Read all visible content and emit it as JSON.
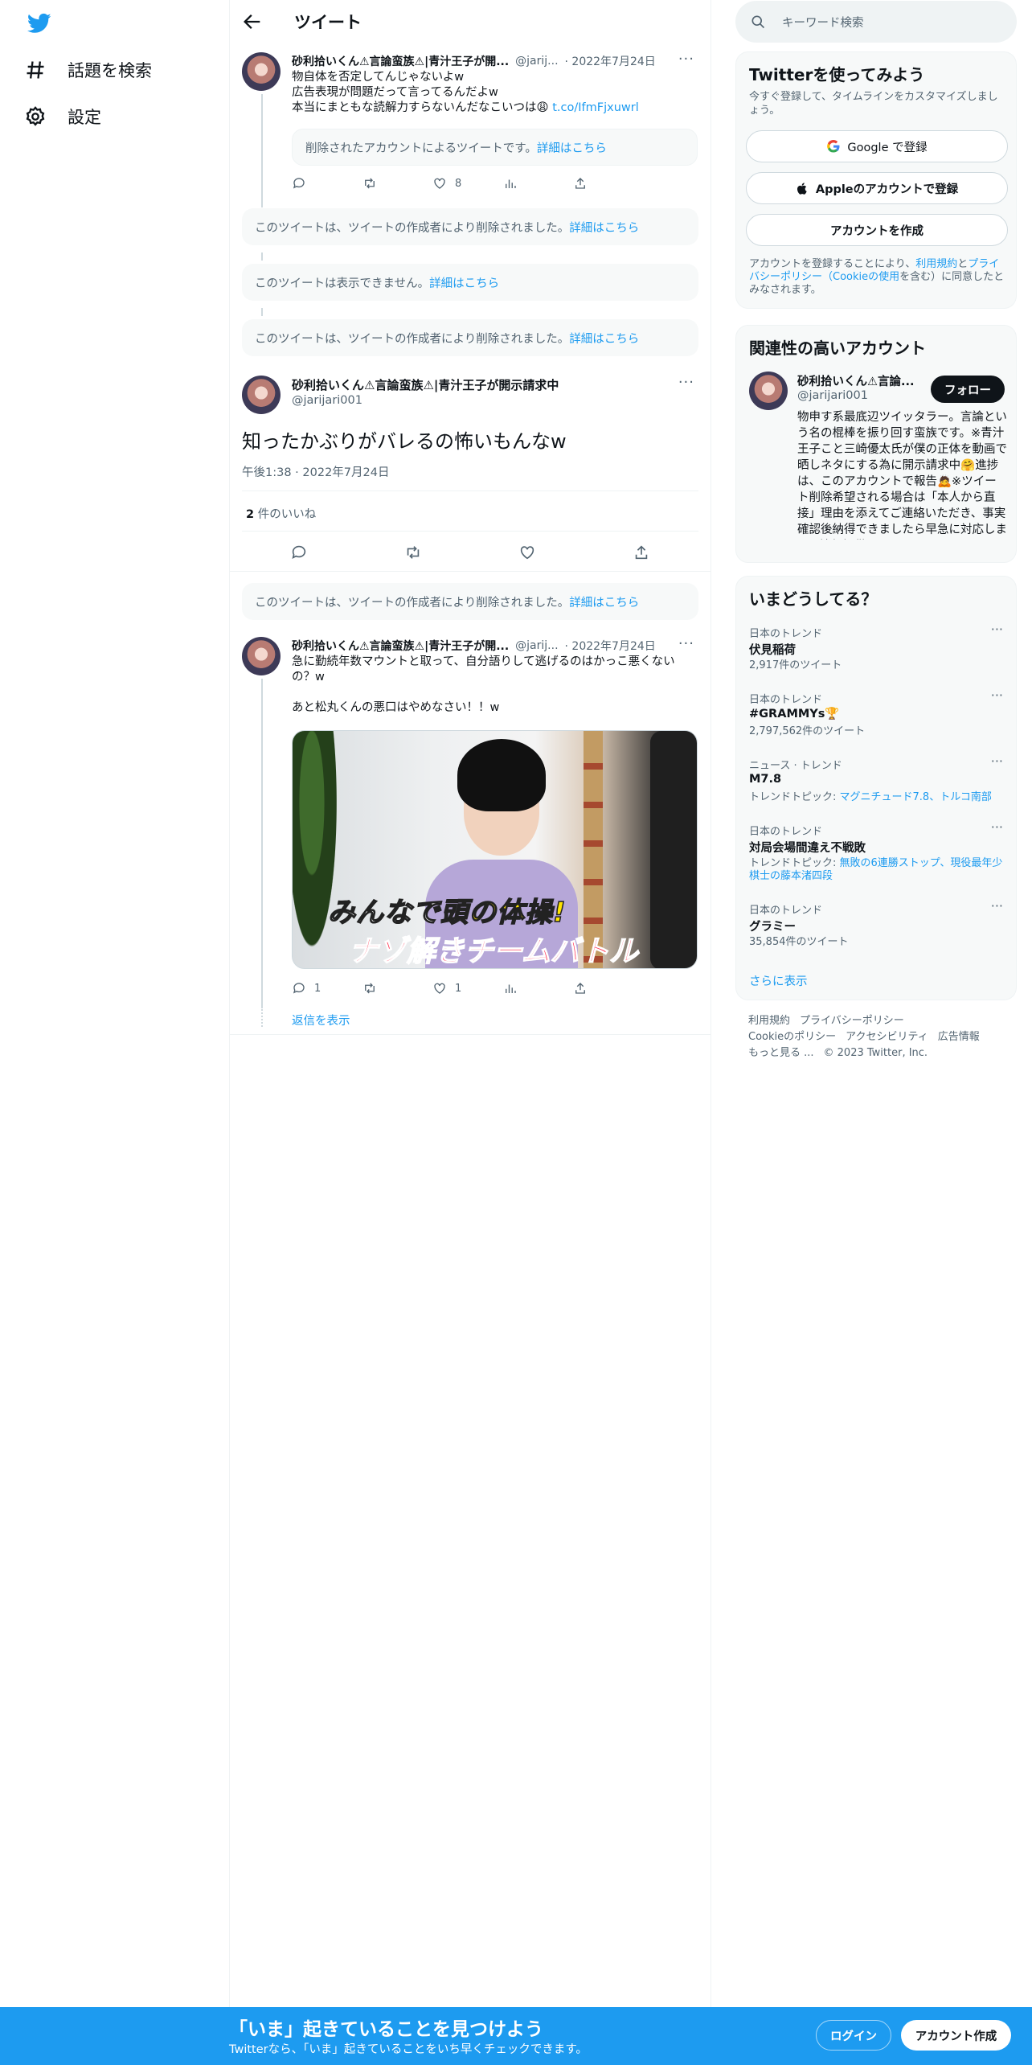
{
  "nav": {
    "logo_icon": "twitter-bird-icon",
    "items": [
      {
        "icon": "hashtag-icon",
        "label": "話題を検索"
      },
      {
        "icon": "gear-icon",
        "label": "設定"
      }
    ]
  },
  "header": {
    "title": "ツイート",
    "back_icon": "arrow-left-icon"
  },
  "thread": {
    "tweet1": {
      "name": "砂利拾いくん⚠言論蛮族⚠|青汁王子が開...",
      "handle": "@jarij...",
      "date": "· 2022年7月24日",
      "text": "物自体を否定してんじゃないよw\n広告表現が問題だって言ってるんだよw\n本当にまともな読解力すらないんだなこいつは😩 ",
      "link": "t.co/IfmFjxuwrl",
      "quote_text": "削除されたアカウントによるツイートです。",
      "quote_link": "詳細はこちら",
      "likes": "8"
    },
    "deleted1": {
      "text": "このツイートは、ツイートの作成者により削除されました。",
      "link": "詳細はこちら"
    },
    "unavailable": {
      "text": "このツイートは表示できません。",
      "link": "詳細はこちら"
    },
    "deleted2": {
      "text": "このツイートは、ツイートの作成者により削除されました。",
      "link": "詳細はこちら"
    },
    "focus": {
      "name": "砂利拾いくん⚠言論蛮族⚠|青汁王子が開示請求中",
      "handle": "@jarijari001",
      "text": "知ったかぶりがバレるの怖いもんなw",
      "time": "午後1:38 · 2022年7月24日",
      "likes_count": "2",
      "likes_label": "件のいいね"
    },
    "deleted3": {
      "text": "このツイートは、ツイートの作成者により削除されました。",
      "link": "詳細はこちら"
    },
    "tweet2": {
      "name": "砂利拾いくん⚠言論蛮族⚠|青汁王子が開...",
      "handle": "@jarij...",
      "date": "· 2022年7月24日",
      "text": "急に勤続年数マウントと取って、自分語りして逃げるのはかっこ悪くないの？w\n\nあと松丸くんの悪口はやめなさい！！w",
      "caption1_a": "みんなで",
      "caption1_b": "頭の体操!",
      "caption2": "ナゾ解きチームバトル",
      "replies": "1",
      "likes": "1",
      "show_replies": "返信を表示"
    }
  },
  "right": {
    "search_placeholder": "キーワード検索",
    "signup": {
      "title": "Twitterを使ってみよう",
      "sub": "今すぐ登録して、タイムラインをカスタマイズしましょう。",
      "google": "Google で登録",
      "apple": "Appleのアカウントで登録",
      "create": "アカウントを作成",
      "fine_a": "アカウントを登録することにより、",
      "fine_terms": "利用規約",
      "fine_b": "と",
      "fine_privacy": "プライバシーポリシー（Cookieの使用",
      "fine_c": "を含む）に同意したとみなされます。"
    },
    "related": {
      "title": "関連性の高いアカウント",
      "name": "砂利拾いくん⚠言論...",
      "handle": "@jarijari001",
      "follow": "フォロー",
      "bio": "物申す系最底辺ツイッタラー。言論という名の棍棒を振り回す蛮族です。※青汁王子こと三崎優太氏が僕の正体を動画で晒しネタにする為に開示請求中🤗進捗は、このアカウントで報告🙇※ツイート削除希望される場合は「本人から直接」理由を添えてご連絡いただき、事実確認後納得できましたら早急に対応します。情報提供はDMで"
    },
    "trends": {
      "title": "いまどうしてる？",
      "items": [
        {
          "category": "日本のトレンド",
          "name": "伏見稲荷",
          "meta": "2,917件のツイート"
        },
        {
          "category": "日本のトレンド",
          "name": "#GRAMMYs🏆",
          "meta": "2,797,562件のツイート"
        },
        {
          "category": "ニュース · トレンド",
          "name": "M7.8",
          "meta_prefix": "トレンドトピック: ",
          "meta_link": "マグニチュード7.8、トルコ南部"
        },
        {
          "category": "日本のトレンド",
          "name": "対局会場間違え不戦敗",
          "meta_prefix": "トレンドトピック: ",
          "meta_link": "無敗の6連勝ストップ、現役最年少棋士の藤本渚四段"
        },
        {
          "category": "日本のトレンド",
          "name": "グラミー",
          "meta": "35,854件のツイート"
        }
      ],
      "show_more": "さらに表示"
    },
    "footer": {
      "terms": "利用規約",
      "privacy": "プライバシーポリシー",
      "cookie": "Cookieのポリシー",
      "accessibility": "アクセシビリティ",
      "ads": "広告情報",
      "more": "もっと見る ...",
      "copyright": "© 2023 Twitter, Inc."
    }
  },
  "banner": {
    "title": "「いま」起きていることを見つけよう",
    "sub": "Twitterなら、「いま」起きていることをいち早くチェックできます。",
    "login": "ログイン",
    "signup": "アカウント作成"
  },
  "colors": {
    "accent": "#1d9bf0",
    "text": "#0f1419",
    "muted": "#536471",
    "banner": "#1d9bf0"
  }
}
